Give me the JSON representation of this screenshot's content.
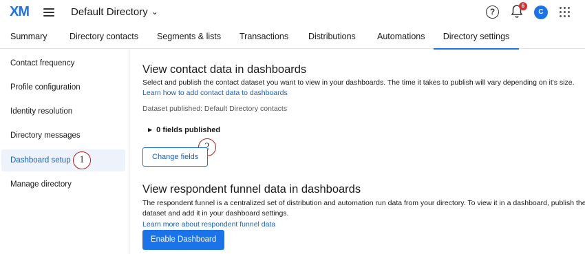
{
  "header": {
    "logo_text": "XM",
    "directory_title": "Default Directory",
    "help_symbol": "?",
    "notification_count": "6",
    "avatar_initial": "C",
    "icons": [
      "hamburger-menu-icon",
      "chevron-down-icon",
      "help-icon",
      "bell-icon",
      "apps-grid-icon"
    ],
    "accent_color": "#1a73e8"
  },
  "tabs": [
    {
      "label": "Summary"
    },
    {
      "label": "Directory contacts"
    },
    {
      "label": "Segments & lists"
    },
    {
      "label": "Transactions"
    },
    {
      "label": "Distributions"
    },
    {
      "label": "Automations"
    },
    {
      "label": "Directory settings",
      "active": true
    }
  ],
  "sidebar": {
    "items": [
      {
        "label": "Contact frequency"
      },
      {
        "label": "Profile configuration"
      },
      {
        "label": "Identity resolution"
      },
      {
        "label": "Directory messages"
      },
      {
        "label": "Dashboard setup",
        "active": true
      },
      {
        "label": "Manage directory"
      }
    ]
  },
  "callouts": [
    "1",
    "2"
  ],
  "contact_section": {
    "title": "View contact data in dashboards",
    "description": "Select and publish the contact dataset you want to view in your dashboards. The time it takes to publish will vary depending on it's size.",
    "link": "Learn how to add contact data to dashboards",
    "dataset_status": "Dataset published: Default Directory contacts",
    "fields_published": "0 fields published",
    "change_button": "Change fields"
  },
  "funnel_section": {
    "title": "View respondent funnel data in dashboards",
    "description_line1": "The respondent funnel is a centralized set of distribution and automation run data from your directory. To view it in a dashboard, publish the",
    "description_line2": "dataset and add it in your dashboard settings.",
    "link": "Learn more about respondent funnel data",
    "enable_button": "Enable Dashboard"
  }
}
